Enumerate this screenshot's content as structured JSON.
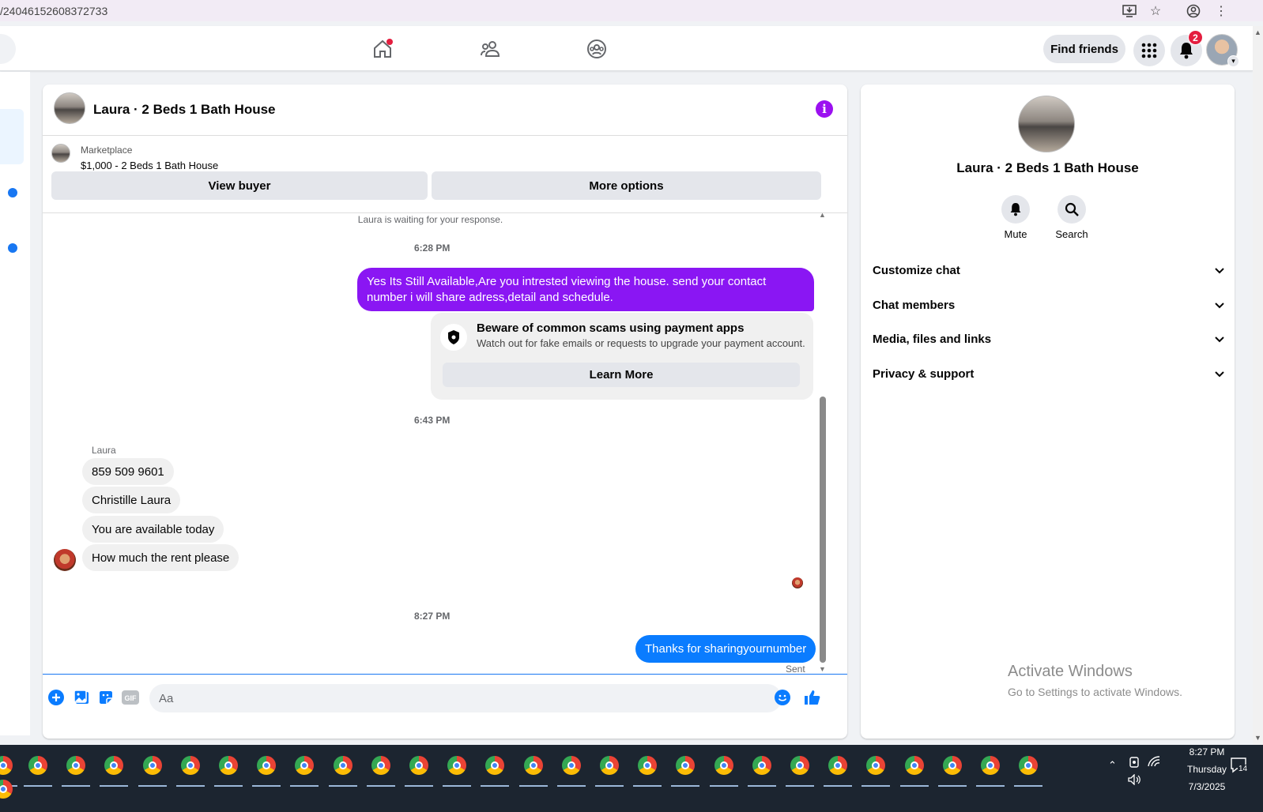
{
  "browser": {
    "url_fragment": "/24046152608372733",
    "icons": [
      "install-icon",
      "star-icon",
      "profile-icon",
      "kebab-icon"
    ]
  },
  "topnav": {
    "find_friends": "Find friends",
    "notif_count": "2"
  },
  "chat": {
    "title": "Laura · 2 Beds 1 Bath House",
    "marketplace_label": "Marketplace",
    "listing": "$1,000 - 2 Beds 1 Bath House",
    "view_buyer": "View buyer",
    "more_options": "More options",
    "waiting": "Laura is waiting for your response.",
    "ts1": "6:28 PM",
    "msg_out1": "Yes Its Still Available,Are you intrested viewing the house. send your contact number i will share adress,detail and schedule.",
    "scam_title": "Beware of common scams using payment apps",
    "scam_sub": "Watch out for fake emails or requests to upgrade your payment account.",
    "learn_more": "Learn More",
    "ts2": "6:43 PM",
    "sender": "Laura",
    "incoming": [
      "859 509 9601",
      "Christille Laura",
      "You are available today",
      "How much the rent please"
    ],
    "ts3": "8:27 PM",
    "msg_out2": "Thanks for sharingyournumber",
    "sent": "Sent",
    "input_placeholder": "Aa"
  },
  "right": {
    "title": "Laura · 2 Beds 1 Bath House",
    "mute": "Mute",
    "search": "Search",
    "rows": [
      "Customize chat",
      "Chat members",
      "Media, files and links",
      "Privacy & support"
    ],
    "activate1": "Activate Windows",
    "activate2": "Go to Settings to activate Windows."
  },
  "taskbar": {
    "time": "8:27 PM",
    "day": "Thursday",
    "date": "7/3/2025",
    "notif": "14"
  },
  "colors": {
    "accent_purple": "#8a16f3",
    "accent_blue": "#0a7cff",
    "fb_blue": "#1877f2"
  }
}
